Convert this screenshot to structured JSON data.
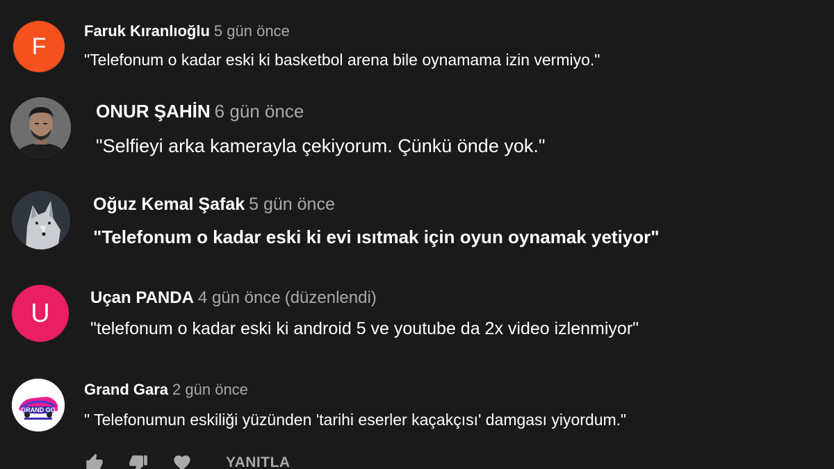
{
  "comments": [
    {
      "author": "Faruk Kıranlıoğlu",
      "time": "5 gün önce",
      "edited": "",
      "text": "\"Telefonum o kadar eski ki basketbol arena bile oynamama izin vermiyo.\"",
      "avatar_letter": "F",
      "avatar_color": "#f4511e"
    },
    {
      "author": "ONUR ŞAHİN",
      "time": "6 gün önce",
      "edited": "",
      "text": "\"Selfieyi arka kamerayla çekiyorum. Çünkü önde yok.\"",
      "avatar_letter": "",
      "avatar_color": "#4a4a4a"
    },
    {
      "author": "Oğuz Kemal Şafak",
      "time": "5 gün önce",
      "edited": "",
      "text": "\"Telefonum o kadar eski ki evi ısıtmak için oyun oynamak yetiyor\"",
      "avatar_letter": "",
      "avatar_color": "#3b434d"
    },
    {
      "author": "Uçan PANDA",
      "time": "4 gün önce",
      "edited": "(düzenlendi)",
      "text": "\"telefonum o kadar eski ki android 5 ve youtube da 2x video izlenmiyor\"",
      "avatar_letter": "U",
      "avatar_color": "#e91e63"
    },
    {
      "author": "Grand Gara",
      "time": "2 gün önce",
      "edited": "",
      "text": "\" Telefonumun eskiliği yüzünden 'tarihi eserler kaçakçısı' damgası yiyordum.\"",
      "avatar_letter": "",
      "avatar_color": "#ffffff",
      "avatar_logo_text": "GRAND GG"
    }
  ],
  "actions": {
    "like_icon": "thumbs-up-icon",
    "dislike_icon": "thumbs-down-icon",
    "heart_icon": "heart-icon",
    "reply_label": "YANITLA"
  },
  "colors": {
    "background": "#1a1a1a",
    "text": "#ffffff",
    "secondary_text": "#aaaaaa"
  }
}
